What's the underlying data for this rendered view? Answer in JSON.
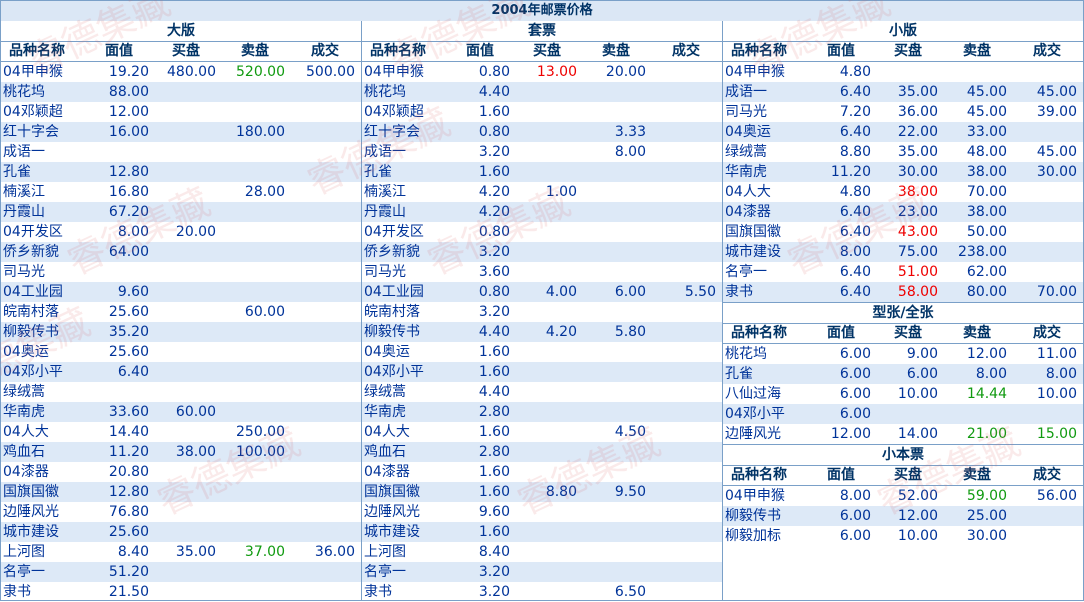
{
  "title": "2004年邮票价格",
  "header": [
    "品种名称",
    "面值",
    "买盘",
    "卖盘",
    "成交"
  ],
  "watermark": "睿德集藏",
  "sections": {
    "daban": {
      "title": "大版",
      "rows": [
        [
          "04甲申猴",
          "19.20",
          "480.00",
          "520.00",
          "500.00"
        ],
        [
          "桃花坞",
          "88.00",
          "",
          "",
          ""
        ],
        [
          "04邓颖超",
          "12.00",
          "",
          "",
          ""
        ],
        [
          "红十字会",
          "16.00",
          "",
          "180.00",
          ""
        ],
        [
          "成语一",
          "",
          "",
          "",
          ""
        ],
        [
          "孔雀",
          "12.80",
          "",
          "",
          ""
        ],
        [
          "楠溪江",
          "16.80",
          "",
          "28.00",
          ""
        ],
        [
          "丹霞山",
          "67.20",
          "",
          "",
          ""
        ],
        [
          "04开发区",
          "8.00",
          "20.00",
          "",
          ""
        ],
        [
          "侨乡新貌",
          "64.00",
          "",
          "",
          ""
        ],
        [
          "司马光",
          "",
          "",
          "",
          ""
        ],
        [
          "04工业园",
          "9.60",
          "",
          "",
          ""
        ],
        [
          "皖南村落",
          "25.60",
          "",
          "60.00",
          ""
        ],
        [
          "柳毅传书",
          "35.20",
          "",
          "",
          ""
        ],
        [
          "04奥运",
          "25.60",
          "",
          "",
          ""
        ],
        [
          "04邓小平",
          "6.40",
          "",
          "",
          ""
        ],
        [
          "绿绒蒿",
          "",
          "",
          "",
          ""
        ],
        [
          "华南虎",
          "33.60",
          "60.00",
          "",
          ""
        ],
        [
          "04人大",
          "14.40",
          "",
          "250.00",
          ""
        ],
        [
          "鸡血石",
          "11.20",
          "38.00",
          "100.00",
          ""
        ],
        [
          "04漆器",
          "20.80",
          "",
          "",
          ""
        ],
        [
          "国旗国徽",
          "12.80",
          "",
          "",
          ""
        ],
        [
          "边陲风光",
          "76.80",
          "",
          "",
          ""
        ],
        [
          "城市建设",
          "25.60",
          "",
          "",
          ""
        ],
        [
          "上河图",
          "8.40",
          "35.00",
          "37.00",
          "36.00"
        ],
        [
          "名亭一",
          "51.20",
          "",
          "",
          ""
        ],
        [
          "隶书",
          "21.50",
          "",
          "",
          ""
        ]
      ],
      "colors": {
        "0_3": "green",
        "24_3": "green"
      }
    },
    "taopiao": {
      "title": "套票",
      "rows": [
        [
          "04甲申猴",
          "0.80",
          "13.00",
          "20.00",
          ""
        ],
        [
          "桃花坞",
          "4.40",
          "",
          "",
          ""
        ],
        [
          "04邓颖超",
          "1.60",
          "",
          "",
          ""
        ],
        [
          "红十字会",
          "0.80",
          "",
          "3.33",
          ""
        ],
        [
          "成语一",
          "3.20",
          "",
          "8.00",
          ""
        ],
        [
          "孔雀",
          "1.60",
          "",
          "",
          ""
        ],
        [
          "楠溪江",
          "4.20",
          "1.00",
          "",
          ""
        ],
        [
          "丹霞山",
          "4.20",
          "",
          "",
          ""
        ],
        [
          "04开发区",
          "0.80",
          "",
          "",
          ""
        ],
        [
          "侨乡新貌",
          "3.20",
          "",
          "",
          ""
        ],
        [
          "司马光",
          "3.60",
          "",
          "",
          ""
        ],
        [
          "04工业园",
          "0.80",
          "4.00",
          "6.00",
          "5.50"
        ],
        [
          "皖南村落",
          "3.20",
          "",
          "",
          ""
        ],
        [
          "柳毅传书",
          "4.40",
          "4.20",
          "5.80",
          ""
        ],
        [
          "04奥运",
          "1.60",
          "",
          "",
          ""
        ],
        [
          "04邓小平",
          "1.60",
          "",
          "",
          ""
        ],
        [
          "绿绒蒿",
          "4.40",
          "",
          "",
          ""
        ],
        [
          "华南虎",
          "2.80",
          "",
          "",
          ""
        ],
        [
          "04人大",
          "1.60",
          "",
          "4.50",
          ""
        ],
        [
          "鸡血石",
          "2.80",
          "",
          "",
          ""
        ],
        [
          "04漆器",
          "1.60",
          "",
          "",
          ""
        ],
        [
          "国旗国徽",
          "1.60",
          "8.80",
          "9.50",
          ""
        ],
        [
          "边陲风光",
          "9.60",
          "",
          "",
          ""
        ],
        [
          "城市建设",
          "1.60",
          "",
          "",
          ""
        ],
        [
          "上河图",
          "8.40",
          "",
          "",
          ""
        ],
        [
          "名亭一",
          "3.20",
          "",
          "",
          ""
        ],
        [
          "隶书",
          "3.20",
          "",
          "6.50",
          ""
        ]
      ],
      "colors": {
        "0_2": "red"
      }
    },
    "xiaoban": {
      "title": "小版",
      "rows": [
        [
          "04甲申猴",
          "4.80",
          "",
          "",
          ""
        ],
        [
          "成语一",
          "6.40",
          "35.00",
          "45.00",
          "45.00"
        ],
        [
          "司马光",
          "7.20",
          "36.00",
          "45.00",
          "39.00"
        ],
        [
          "04奥运",
          "6.40",
          "22.00",
          "33.00",
          ""
        ],
        [
          "绿绒蒿",
          "8.80",
          "35.00",
          "48.00",
          "45.00"
        ],
        [
          "华南虎",
          "11.20",
          "30.00",
          "38.00",
          "30.00"
        ],
        [
          "04人大",
          "4.80",
          "38.00",
          "70.00",
          ""
        ],
        [
          "04漆器",
          "6.40",
          "23.00",
          "38.00",
          ""
        ],
        [
          "国旗国徽",
          "6.40",
          "43.00",
          "50.00",
          ""
        ],
        [
          "城市建设",
          "8.00",
          "75.00",
          "238.00",
          ""
        ],
        [
          "名亭一",
          "6.40",
          "51.00",
          "62.00",
          ""
        ],
        [
          "隶书",
          "6.40",
          "58.00",
          "80.00",
          "70.00"
        ]
      ],
      "colors": {
        "6_2": "red",
        "8_2": "red",
        "10_2": "red",
        "11_2": "red"
      }
    },
    "xingzhang": {
      "title": "型张/全张",
      "rows": [
        [
          "桃花坞",
          "6.00",
          "9.00",
          "12.00",
          "11.00"
        ],
        [
          "孔雀",
          "6.00",
          "6.00",
          "8.00",
          "8.00"
        ],
        [
          "八仙过海",
          "6.00",
          "10.00",
          "14.44",
          "10.00"
        ],
        [
          "04邓小平",
          "6.00",
          "",
          "",
          ""
        ],
        [
          "边陲风光",
          "12.00",
          "14.00",
          "21.00",
          "15.00"
        ]
      ],
      "colors": {
        "2_3": "green",
        "4_3": "green",
        "4_4": "green"
      }
    },
    "xiaobenpiao": {
      "title": "小本票",
      "rows": [
        [
          "04甲申猴",
          "8.00",
          "52.00",
          "59.00",
          "56.00"
        ],
        [
          "柳毅传书",
          "6.00",
          "12.00",
          "25.00",
          ""
        ],
        [
          "柳毅加标",
          "6.00",
          "10.00",
          "30.00",
          ""
        ]
      ],
      "colors": {
        "0_3": "green"
      }
    }
  }
}
